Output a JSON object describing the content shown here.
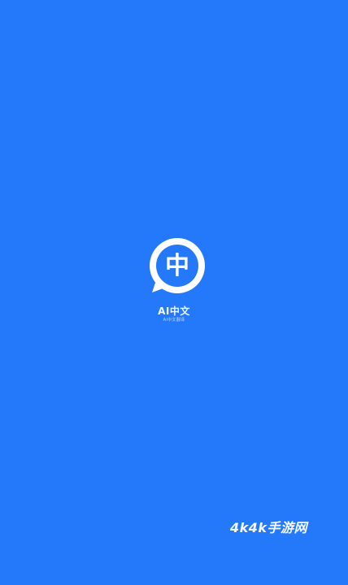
{
  "splash": {
    "logo_glyph": "中",
    "app_name": "AI中文",
    "app_slogan": "AI中文翻译",
    "watermark": "4k4k手游网"
  },
  "colors": {
    "background": "#2479fb",
    "logo_ring": "#ffffff",
    "logo_inner": "#2479fb"
  },
  "icons": {
    "logo": "chat-bubble-logo-icon"
  }
}
